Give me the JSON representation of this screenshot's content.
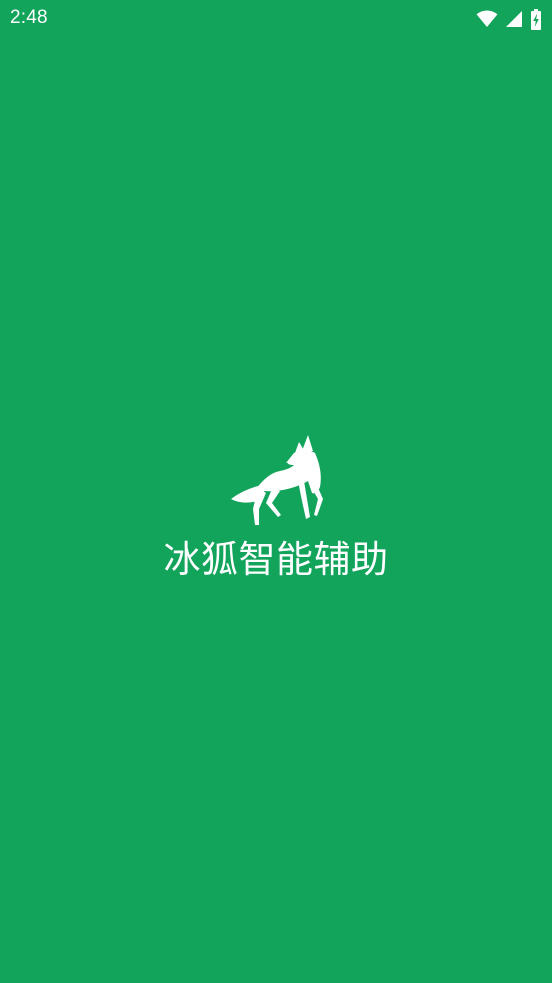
{
  "status_bar": {
    "time": "2:48",
    "icons": [
      "wifi-icon",
      "cellular-signal-icon",
      "battery-charging-icon"
    ]
  },
  "splash": {
    "app_name": "冰狐智能辅助",
    "logo_icon": "fox-icon"
  },
  "colors": {
    "background": "#13a45c",
    "foreground": "#ffffff"
  }
}
